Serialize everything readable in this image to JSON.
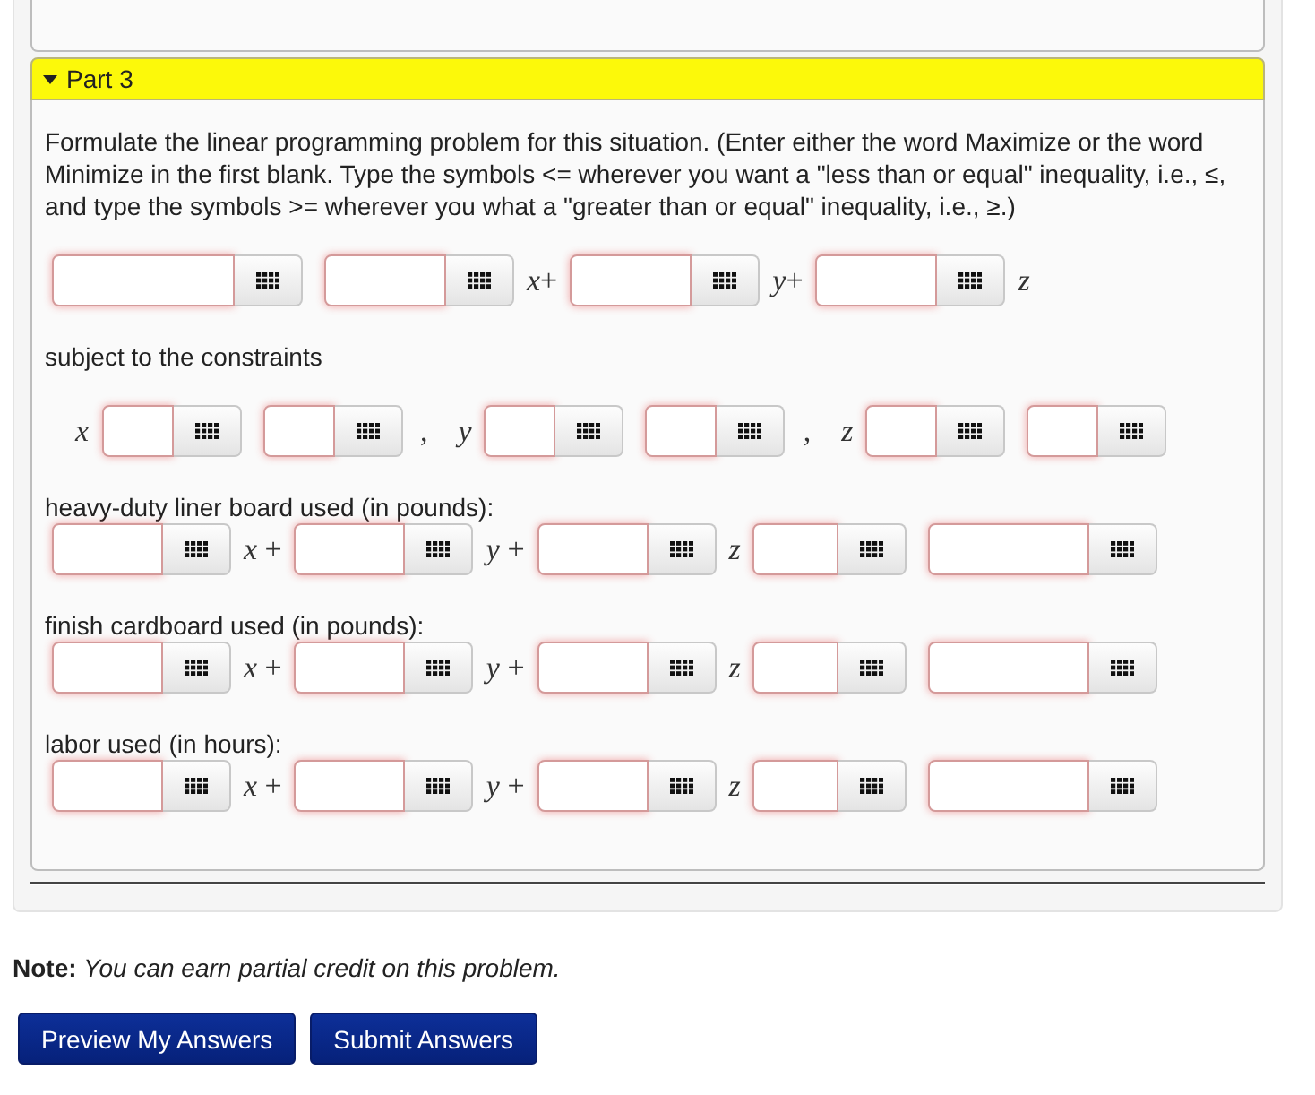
{
  "part": {
    "title": "Part 3",
    "expanded": true,
    "instructions": "Formulate the linear programming problem for this situation. (Enter either the word Maximize or the word Minimize in the first blank. Type the symbols <= wherever you want a \"less than or equal\" inequality, i.e., ≤, and type the symbols >= wherever you what a \"greater than or equal\" inequality, i.e., ≥.)",
    "objective": [
      {
        "kind": "blank",
        "highlighted": true
      },
      {
        "kind": "blank",
        "highlighted": true
      },
      {
        "kind": "term",
        "text": "*x*+"
      },
      {
        "kind": "blank",
        "highlighted": true
      },
      {
        "kind": "term",
        "text": "*y*+"
      },
      {
        "kind": "blank",
        "highlighted": true
      },
      {
        "kind": "variable",
        "text": "z"
      }
    ],
    "constraints_intro": "subject to the constraints",
    "bounds": [
      {
        "kind": "variable",
        "text": "x"
      },
      {
        "kind": "blank",
        "highlighted": true
      },
      {
        "kind": "blank",
        "highlighted": true
      },
      {
        "kind": "separator",
        "text": ","
      },
      {
        "kind": "variable",
        "text": "y"
      },
      {
        "kind": "blank",
        "highlighted": true
      },
      {
        "kind": "blank",
        "highlighted": true
      },
      {
        "kind": "separator",
        "text": ","
      },
      {
        "kind": "variable",
        "text": "z"
      },
      {
        "kind": "blank",
        "highlighted": true
      },
      {
        "kind": "blank",
        "highlighted": true
      }
    ],
    "constraints": [
      {
        "label": "heavy-duty liner board used (in pounds):",
        "items": [
          {
            "kind": "blank",
            "highlighted": true
          },
          {
            "kind": "term",
            "text": "*x* +"
          },
          {
            "kind": "blank",
            "highlighted": true
          },
          {
            "kind": "term",
            "text": "*y* +"
          },
          {
            "kind": "blank",
            "highlighted": true
          },
          {
            "kind": "variable",
            "text": "z"
          },
          {
            "kind": "blank",
            "highlighted": true
          },
          {
            "kind": "blank",
            "highlighted": true
          }
        ]
      },
      {
        "label": "finish cardboard used (in pounds):",
        "items": [
          {
            "kind": "blank",
            "highlighted": true
          },
          {
            "kind": "term",
            "text": "*x* +"
          },
          {
            "kind": "blank",
            "highlighted": true
          },
          {
            "kind": "term",
            "text": "*y* +"
          },
          {
            "kind": "blank",
            "highlighted": true
          },
          {
            "kind": "variable",
            "text": "z"
          },
          {
            "kind": "blank",
            "highlighted": true
          },
          {
            "kind": "blank",
            "highlighted": true
          }
        ]
      },
      {
        "label": "labor used (in hours):",
        "items": [
          {
            "kind": "blank",
            "highlighted": true
          },
          {
            "kind": "term",
            "text": "*x* +"
          },
          {
            "kind": "blank",
            "highlighted": true
          },
          {
            "kind": "term",
            "text": "*y* +"
          },
          {
            "kind": "blank",
            "highlighted": true
          },
          {
            "kind": "variable",
            "text": "z"
          },
          {
            "kind": "blank",
            "highlighted": true
          },
          {
            "kind": "blank",
            "highlighted": true
          }
        ]
      }
    ]
  },
  "note": "**Note:** *You can earn partial credit on this problem.*",
  "buttons": [
    "Preview My Answers",
    "Submit Answers"
  ]
}
